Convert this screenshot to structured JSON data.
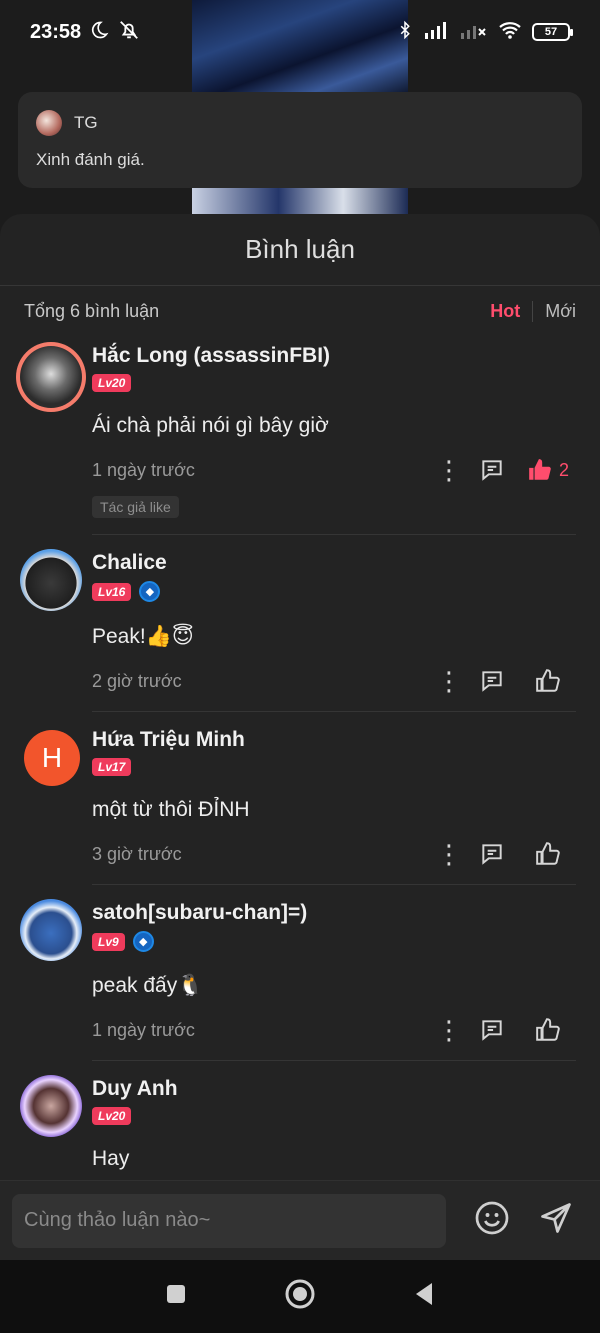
{
  "status": {
    "time": "23:58",
    "battery": "57",
    "icons": [
      "moon-icon",
      "mute-icon",
      "bluetooth-icon",
      "signal-icon",
      "signal-x-icon",
      "wifi-icon",
      "battery-icon"
    ]
  },
  "notification": {
    "sender": "TG",
    "message": "Xinh đánh giá."
  },
  "sheet": {
    "title": "Bình luận",
    "total": "Tổng 6 bình luận",
    "sort_hot": "Hot",
    "sort_new": "Mới",
    "accent": "#ff4d6d"
  },
  "comments": [
    {
      "name": "Hắc Long (assassinFBI)",
      "level": "Lv20",
      "verified": false,
      "text": "Ái chà phải nói gì bây giờ",
      "time": "1 ngày trước",
      "likes": "2",
      "liked": true,
      "tag": "Tác giả like"
    },
    {
      "name": "Chalice",
      "level": "Lv16",
      "verified": true,
      "text": "Peak!👍😇",
      "time": "2 giờ trước"
    },
    {
      "name": "Hứa Triệu Minh",
      "avatar_letter": "H",
      "level": "Lv17",
      "verified": false,
      "text": "một từ thôi ĐỈNH",
      "time": "3 giờ trước"
    },
    {
      "name": "satoh[subaru-chan]=)",
      "level": "Lv9",
      "verified": true,
      "text": "peak đấy🐧",
      "time": "1 ngày trước"
    },
    {
      "name": "Duy Anh",
      "level": "Lv20",
      "verified": false,
      "text": "Hay"
    }
  ],
  "input": {
    "placeholder": "Cùng thảo luận nào~"
  }
}
